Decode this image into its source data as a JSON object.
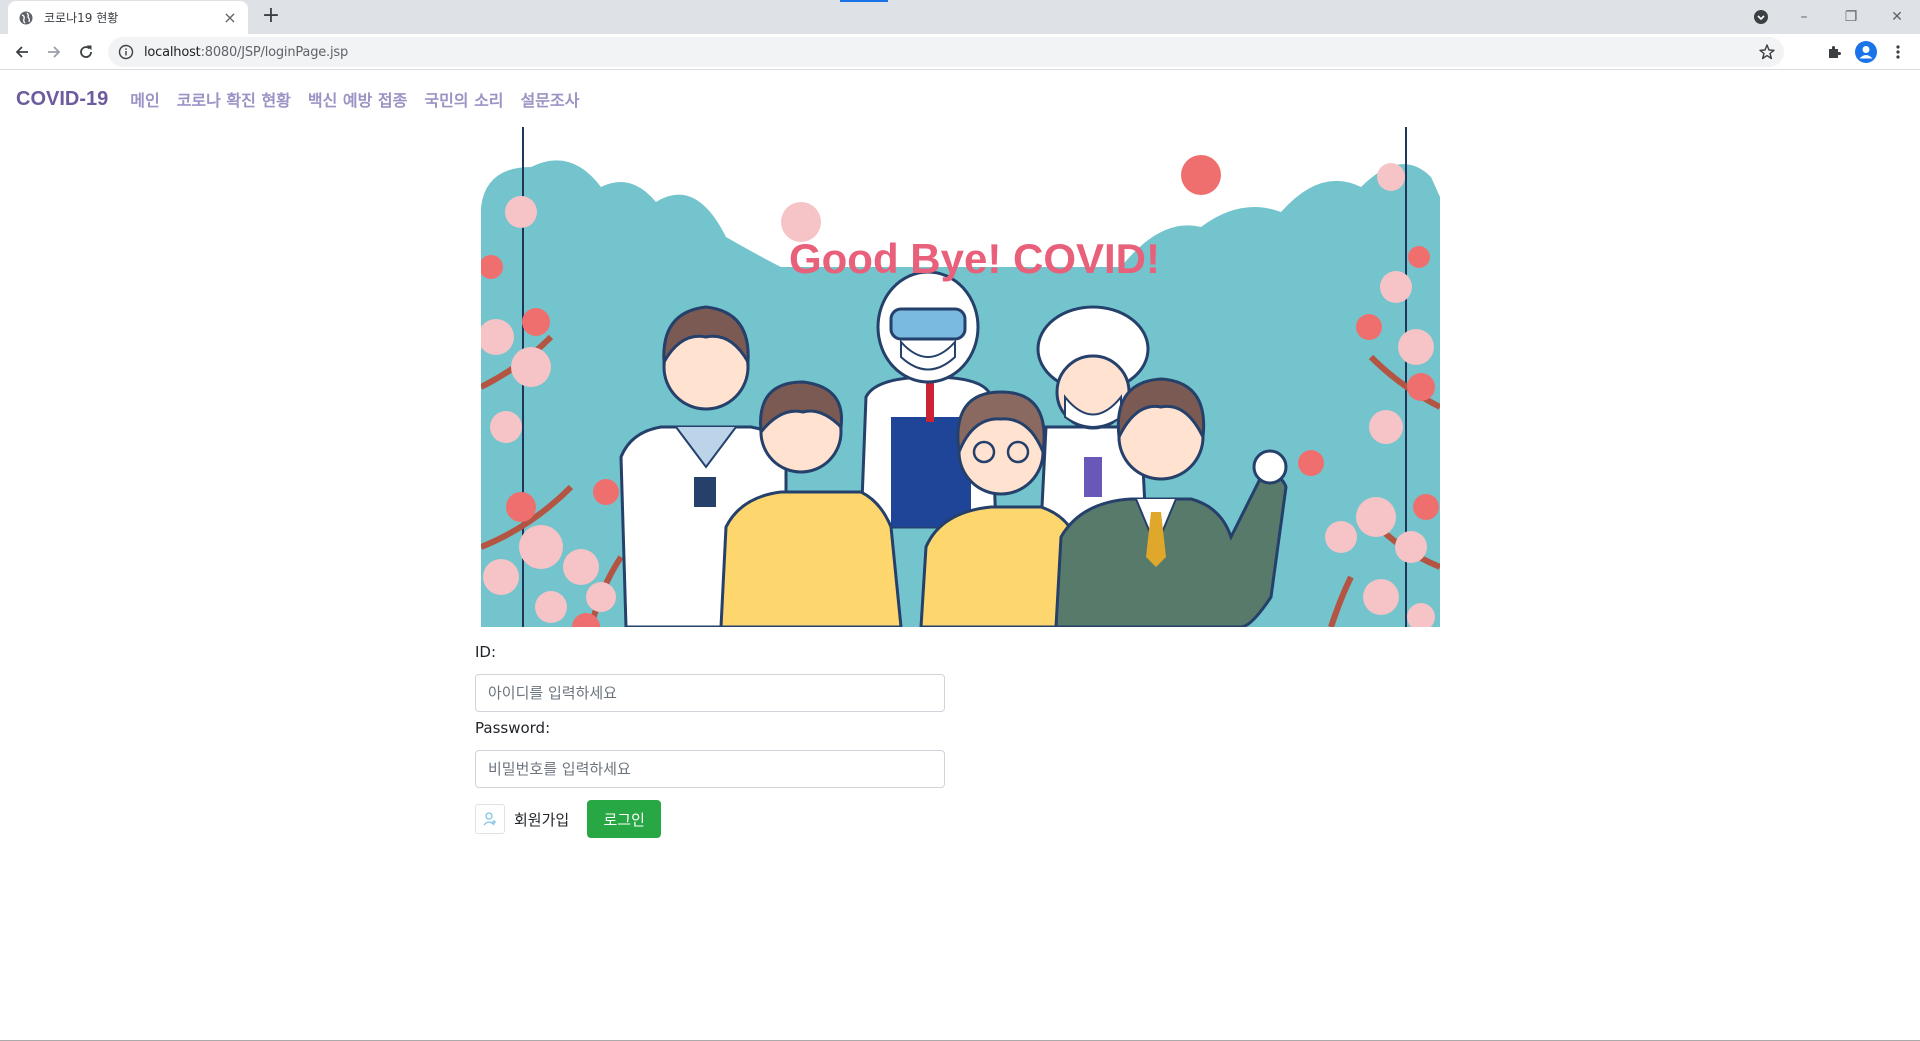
{
  "browser": {
    "tab_title": "코로나19 현황",
    "tab_close": "×",
    "new_tab": "+",
    "url_host": "localhost",
    "url_rest": ":8080/JSP/loginPage.jsp",
    "window_minimize": "–",
    "window_restore": "❐",
    "window_close": "✕"
  },
  "navbar": {
    "brand": "COVID-19",
    "links": [
      "메인",
      "코로나 확진 현황",
      "백신 예방 접종",
      "국민의 소리",
      "설문조사"
    ]
  },
  "hero": {
    "title": "Good Bye! COVID!",
    "colors": {
      "sky": "#73c4cc",
      "title": "#e8607a",
      "blossom": "#f6c3c6",
      "blossom_dark": "#ef6f6f"
    }
  },
  "form": {
    "id_label": "ID:",
    "id_placeholder": "아이디를 입력하세요",
    "password_label": "Password:",
    "password_placeholder": "비밀번호를 입력하세요",
    "signup_label": "회원가입",
    "login_label": "로그인",
    "signup_icon": "user-add-icon"
  },
  "colors": {
    "brand": "#6e5b9d",
    "nav_link": "#9c93c5",
    "login_button": "#28a745"
  }
}
